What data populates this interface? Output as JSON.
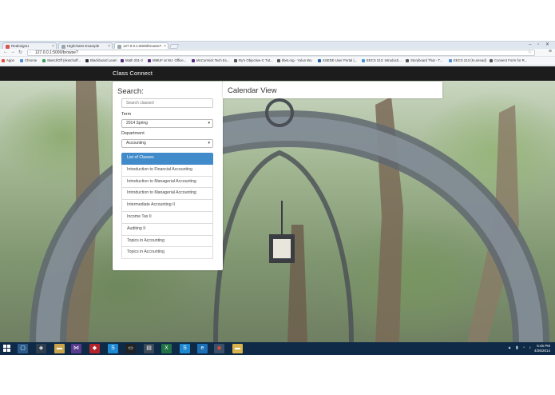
{
  "browser": {
    "tabs": [
      {
        "label": "RedesignU",
        "icon_color": "#d9534f"
      },
      {
        "label": "Highcharts Example",
        "icon_color": "#9aa6b2"
      },
      {
        "label": "127.0.0.1:5000/browse?",
        "icon_color": "#9aa6b2"
      }
    ],
    "window_controls": "–  ▫  ✕",
    "url": "127.0.0.1:5000/browse?",
    "bookmarks": [
      {
        "label": "Apps",
        "color": "#e74c3c"
      },
      {
        "label": "Chrome",
        "color": "#4a90d9"
      },
      {
        "label": "SketchOff (sketchoff...",
        "color": "#3c9d5d"
      },
      {
        "label": "Blackboard Learn",
        "color": "#333333"
      },
      {
        "label": "Math 201-3",
        "color": "#5b2b82"
      },
      {
        "label": "MMUF at NU: Office...",
        "color": "#5b2b82"
      },
      {
        "label": "McCormick Tech Ex...",
        "color": "#5b2b82"
      },
      {
        "label": "Ry's Objective-C Tut...",
        "color": "#555555"
      },
      {
        "label": "tibet.org - Yulun Wu",
        "color": "#555555"
      },
      {
        "label": "XSEDE User Portal |...",
        "color": "#1f5fa8"
      },
      {
        "label": "EECS 213: Introducti...",
        "color": "#4a90d9"
      },
      {
        "label": "Storyboard That - T...",
        "color": "#555555"
      },
      {
        "label": "EECS 213 (8 unread)",
        "color": "#4a90d9"
      },
      {
        "label": "Consent Form for R...",
        "color": "#555555"
      }
    ]
  },
  "app": {
    "brand": "Class Connect"
  },
  "search": {
    "title": "Search:",
    "placeholder": "Search classes!",
    "term_label": "Term",
    "term_value": "2014 Spring",
    "department_label": "Department",
    "department_value": "Accounting",
    "list_header": "List of Classes",
    "classes": [
      "Introduction to Financial Accounting",
      "Introduction to Managerial Accounting",
      "Introduction to Managerial Accounting",
      "Intermediate Accounting II",
      "Income Tax II",
      "Auditing II",
      "Topics in Accounting",
      "Topics in Accounting"
    ]
  },
  "calendar": {
    "title": "Calendar View"
  },
  "taskbar": {
    "apps": [
      {
        "name": "task-view-icon",
        "glyph": "▢"
      },
      {
        "name": "unity-icon",
        "glyph": "◈"
      },
      {
        "name": "file-explorer-icon",
        "glyph": "▬"
      },
      {
        "name": "visual-studio-icon",
        "glyph": "⋈"
      },
      {
        "name": "red-app-icon",
        "glyph": "◆"
      },
      {
        "name": "skype-icon",
        "glyph": "S"
      },
      {
        "name": "terminal-icon",
        "glyph": "▭"
      },
      {
        "name": "chart-app-icon",
        "glyph": "▤"
      },
      {
        "name": "excel-icon",
        "glyph": "X"
      },
      {
        "name": "skype-2-icon",
        "glyph": "S"
      },
      {
        "name": "ie-icon",
        "glyph": "e"
      },
      {
        "name": "chrome-icon",
        "glyph": "◉"
      },
      {
        "name": "folder-icon",
        "glyph": "▬"
      }
    ],
    "time": "5:45 PM",
    "date": "4/26/2014"
  }
}
